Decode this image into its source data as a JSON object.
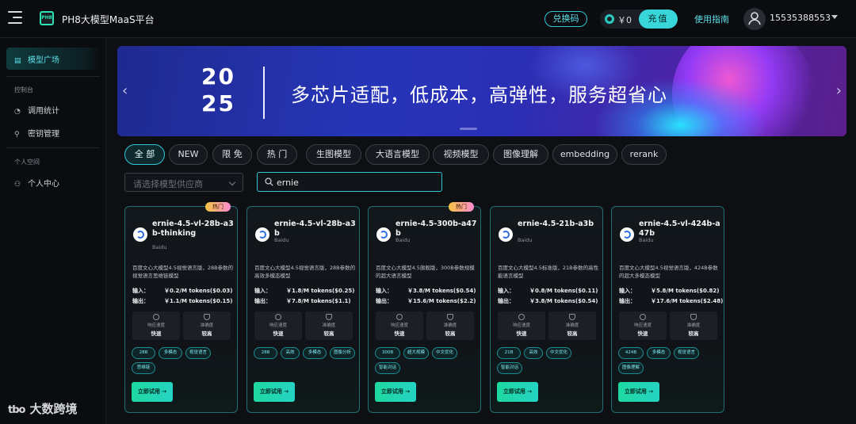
{
  "header": {
    "logo_text": "PH8",
    "app_title": "PH8大模型MaaS平台",
    "redeem_label": "兑换码",
    "balance": "￥0",
    "recharge_label": "充值",
    "guide_label": "使用指南",
    "user_phone": "15535388553"
  },
  "sidebar": {
    "active_item": "模型广场",
    "section_console": "控制台",
    "items_console": [
      "调用统计",
      "密钥管理"
    ],
    "section_personal": "个人空间",
    "items_personal": [
      "个人中心"
    ]
  },
  "banner": {
    "year_top": "20",
    "year_bottom": "25",
    "slogan": "多芯片适配，低成本，高弹性，服务超省心"
  },
  "filters": {
    "chips": [
      "全 部",
      "NEW",
      "限 免",
      "热 门",
      "生图模型",
      "大语言模型",
      "视频模型",
      "图像理解",
      "embedding",
      "rerank"
    ],
    "active_index": 0
  },
  "search": {
    "provider_placeholder": "请选择模型供应商",
    "query": "ernie"
  },
  "cards": [
    {
      "name": "ernie-4.5-vl-28b-a3b-thinking",
      "provider": "Baidu",
      "badge": "热门",
      "desc": "百度文心大模型4.5视觉语言版，28B参数的视觉语言思维链模型",
      "input_label": "输入：",
      "input_price": "￥0.2/M tokens($0.03)",
      "output_label": "输出：",
      "output_price": "￥1.1/M tokens($0.15)",
      "speed_label": "响应速度",
      "speed_value": "快速",
      "accuracy_label": "准确度",
      "accuracy_value": "较高",
      "tags": [
        "28B",
        "多模态",
        "视觉语言",
        "思维链"
      ],
      "try_label": "立即试用 →"
    },
    {
      "name": "ernie-4.5-vl-28b-a3b",
      "provider": "Baidu",
      "badge": "",
      "desc": "百度文心大模型4.5视觉语言版，28B参数的高效多模态模型",
      "input_label": "输入：",
      "input_price": "￥1.8/M tokens($0.25)",
      "output_label": "输出：",
      "output_price": "￥7.8/M tokens($1.1)",
      "speed_label": "响应速度",
      "speed_value": "快速",
      "accuracy_label": "准确度",
      "accuracy_value": "较高",
      "tags": [
        "28B",
        "高效",
        "多模态",
        "图像分析"
      ],
      "try_label": "立即试用 →"
    },
    {
      "name": "ernie-4.5-300b-a47b",
      "provider": "Baidu",
      "badge": "热门",
      "desc": "百度文心大模型4.5旗舰版，300B参数规模的超大语言模型",
      "input_label": "输入：",
      "input_price": "￥3.8/M tokens($0.54)",
      "output_label": "输出：",
      "output_price": "￥15.6/M tokens($2.2)",
      "speed_label": "响应速度",
      "speed_value": "快速",
      "accuracy_label": "准确度",
      "accuracy_value": "较高",
      "tags": [
        "300B",
        "超大规模",
        "中文优化",
        "智能对话"
      ],
      "try_label": "立即试用 →"
    },
    {
      "name": "ernie-4.5-21b-a3b",
      "provider": "Baidu",
      "badge": "",
      "desc": "百度文心大模型4.5标准版，21B参数的高性能语言模型",
      "input_label": "输入：",
      "input_price": "￥0.8/M tokens($0.11)",
      "output_label": "输出：",
      "output_price": "￥3.8/M tokens($0.54)",
      "speed_label": "响应速度",
      "speed_value": "快速",
      "accuracy_label": "准确度",
      "accuracy_value": "较高",
      "tags": [
        "21B",
        "高效",
        "中文优化",
        "智能对话"
      ],
      "try_label": "立即试用 →"
    },
    {
      "name": "ernie-4.5-vl-424b-a47b",
      "provider": "Baidu",
      "badge": "",
      "desc": "百度文心大模型4.5视觉语言版，424B参数的超大多模态模型",
      "input_label": "输入：",
      "input_price": "￥5.8/M tokens($0.82)",
      "output_label": "输出：",
      "output_price": "￥17.6/M tokens($2.48)",
      "speed_label": "响应速度",
      "speed_value": "快速",
      "accuracy_label": "准确度",
      "accuracy_value": "较高",
      "tags": [
        "424B",
        "多模态",
        "视觉语言",
        "图像理解"
      ],
      "try_label": "立即试用 →"
    }
  ],
  "watermark": {
    "logo": "tbo",
    "text": "大数跨境"
  },
  "colors": {
    "accent": "#2ec7d6",
    "try_button": "#1ed8a0",
    "hot_badge": "#f5c542"
  }
}
